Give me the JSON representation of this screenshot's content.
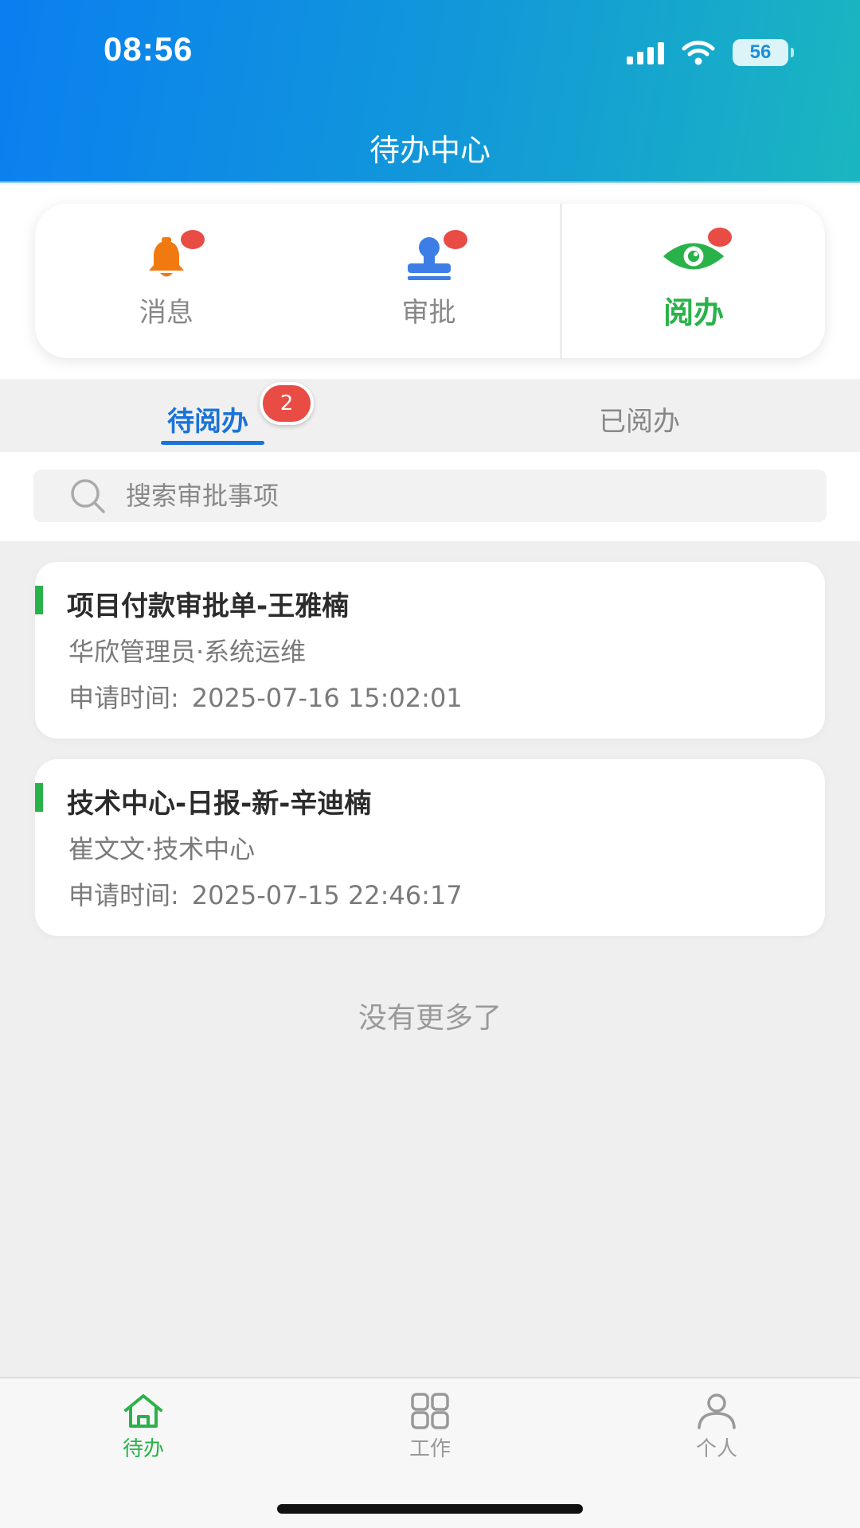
{
  "status_bar": {
    "time": "08:56",
    "battery": "56"
  },
  "header": {
    "title": "待办中心"
  },
  "categories": [
    {
      "label": "消息",
      "icon": "bell-icon",
      "color": "#f07a10",
      "has_dot": true,
      "active": false
    },
    {
      "label": "审批",
      "icon": "stamp-icon",
      "color": "#3d7ee6",
      "has_dot": true,
      "active": false
    },
    {
      "label": "阅办",
      "icon": "eye-icon",
      "color": "#2ab24a",
      "has_dot": true,
      "active": true
    }
  ],
  "tabs": {
    "pending": "待阅办",
    "done": "已阅办",
    "pending_badge": "2"
  },
  "search": {
    "placeholder": "搜索审批事项"
  },
  "items": [
    {
      "title": "项目付款审批单-王雅楠",
      "subtitle": "华欣管理员·系统运维",
      "time_label": "申请时间:",
      "time_value": "2025-07-16 15:02:01"
    },
    {
      "title": "技术中心-日报-新-辛迪楠",
      "subtitle": "崔文文·技术中心",
      "time_label": "申请时间:",
      "time_value": "2025-07-15 22:46:17"
    }
  ],
  "list_footer": "没有更多了",
  "bottom_nav": [
    {
      "label": "待办",
      "icon": "home-icon",
      "active": true
    },
    {
      "label": "工作",
      "icon": "grid-icon",
      "active": false
    },
    {
      "label": "个人",
      "icon": "person-icon",
      "active": false
    }
  ],
  "colors": {
    "accent_blue": "#1a73d8",
    "accent_green": "#2ab24a",
    "badge_red": "#e84c45"
  }
}
